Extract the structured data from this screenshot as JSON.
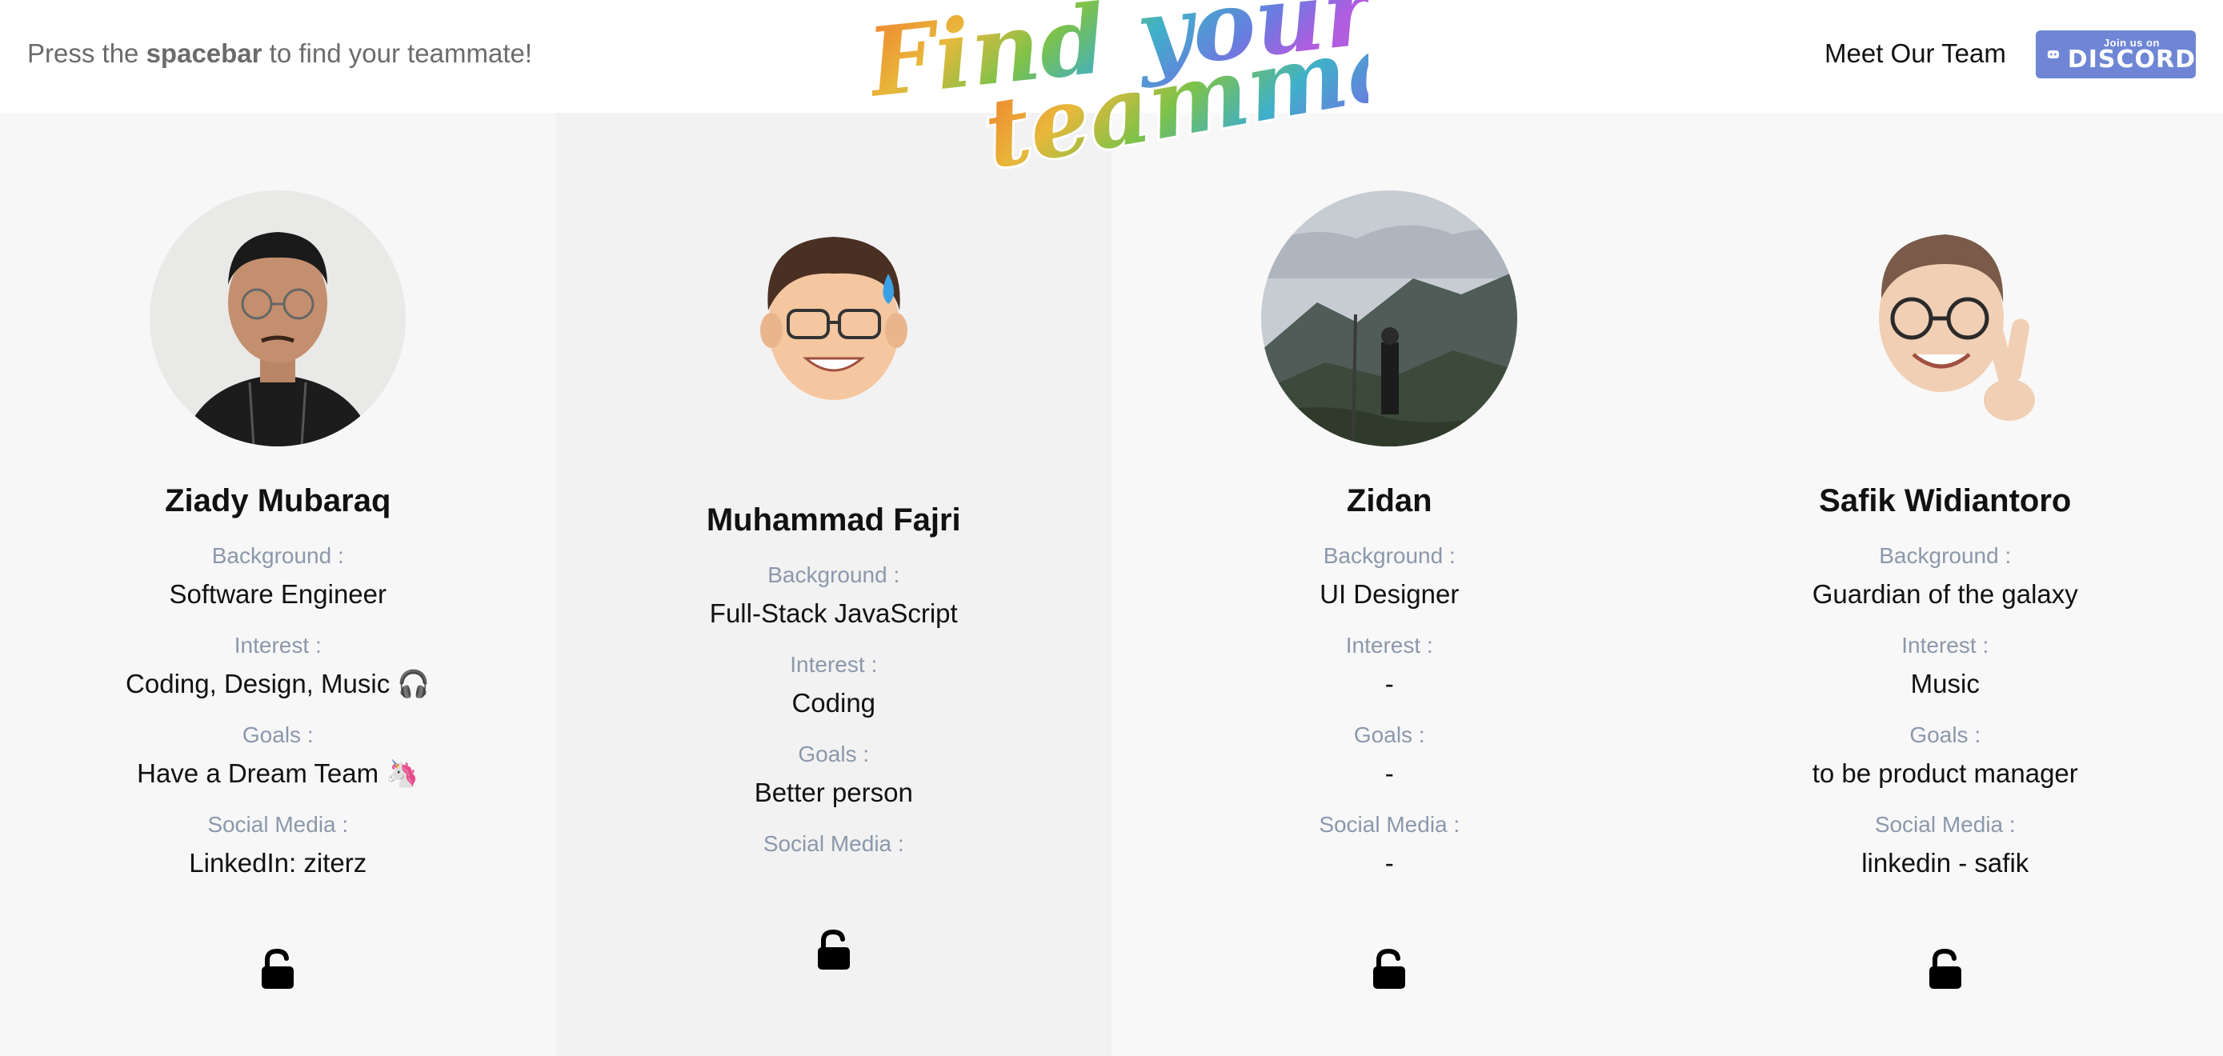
{
  "header": {
    "hint_prefix": "Press the ",
    "hint_bold": "spacebar",
    "hint_suffix": " to find your teammate!",
    "title_line1": "Find your",
    "title_line2": "teammate!",
    "nav_link": "Meet Our Team",
    "discord_small": "Join us on",
    "discord_big": "DISCORD"
  },
  "labels": {
    "background": "Background :",
    "interest": "Interest :",
    "goals": "Goals :",
    "social": "Social Media :"
  },
  "members": [
    {
      "name": "Ziady Mubaraq",
      "background": "Software Engineer",
      "interest": "Coding, Design, Music 🎧",
      "goals": "Have a Dream Team 🦄",
      "social": "LinkedIn: ziterz",
      "avatar": "photo-portrait",
      "lock": "unlocked"
    },
    {
      "name": "Muhammad Fajri",
      "background": "Full-Stack JavaScript",
      "interest": "Coding",
      "goals": "Better person",
      "social": "",
      "avatar": "memoji-sweat",
      "lock": "unlocked"
    },
    {
      "name": "Zidan",
      "background": "UI Designer",
      "interest": "-",
      "goals": "-",
      "social": "-",
      "avatar": "photo-mountain",
      "lock": "unlocked"
    },
    {
      "name": "Safik Widiantoro",
      "background": "Guardian of the galaxy",
      "interest": "Music",
      "goals": "to be product manager",
      "social": "linkedin - safik",
      "avatar": "memoji-fingers-crossed",
      "lock": "unlocked"
    }
  ],
  "colors": {
    "discord": "#6f86d6",
    "label": "#8c98ab"
  }
}
